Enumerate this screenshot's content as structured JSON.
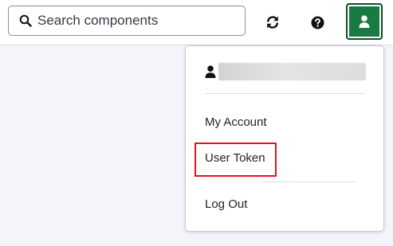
{
  "search": {
    "placeholder": "Search components",
    "value": ""
  },
  "toolbar": {
    "refresh_icon": "refresh-icon",
    "help_icon": "question-circle-icon",
    "avatar_icon": "user-icon"
  },
  "menu": {
    "user_icon": "user-icon",
    "items": [
      {
        "label": "My Account"
      },
      {
        "label": "User Token"
      },
      {
        "label": "Log Out"
      }
    ]
  },
  "colors": {
    "accent": "#1a7a43",
    "highlight": "#e0141e",
    "background": "#f4f5fb"
  }
}
